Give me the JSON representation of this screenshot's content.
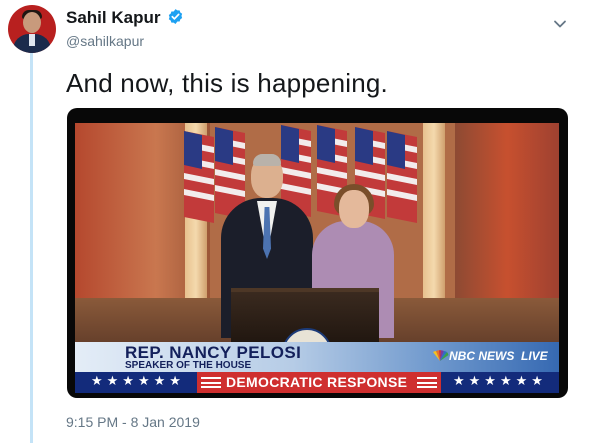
{
  "tweet": {
    "author": {
      "display_name": "Sahil Kapur",
      "handle": "@sahilkapur",
      "verified": true,
      "verified_icon": "verified-badge-icon"
    },
    "menu_icon": "chevron-down-icon",
    "text": "And now, this is happening.",
    "timestamp": "9:15 PM - 8 Jan 2019"
  },
  "media": {
    "chyron": {
      "name": "REP. NANCY PELOSI",
      "title": "SPEAKER OF THE HOUSE",
      "network": "NBC NEWS",
      "live": "LIVE"
    },
    "banner": {
      "text": "DEMOCRATIC RESPONSE",
      "stars_left": "★★★★★★",
      "stars_right": "★★★★★★"
    }
  },
  "colors": {
    "verified_blue": "#1da1f2",
    "thread_line": "#c4e3f7",
    "banner_blue": "#132b7b",
    "banner_red": "#cf2f2f",
    "secondary_text": "#657786"
  }
}
